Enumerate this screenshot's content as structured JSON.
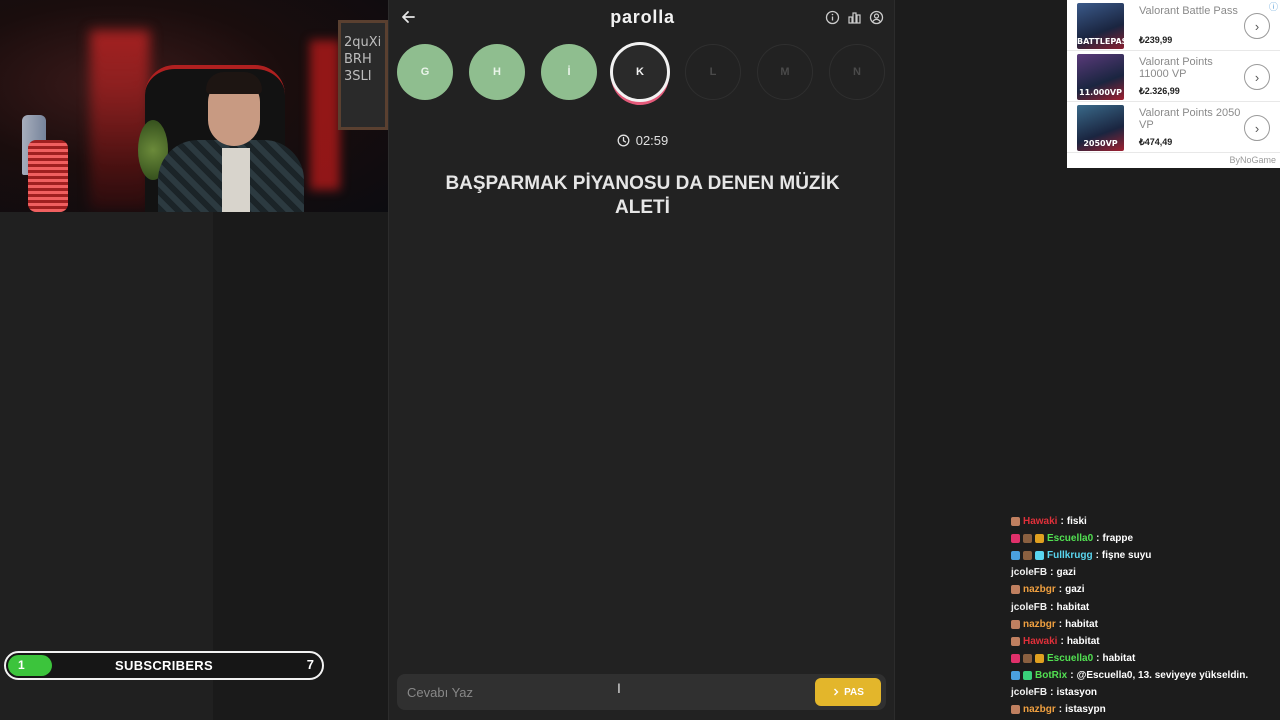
{
  "app": {
    "brand": "parolla"
  },
  "game": {
    "letters": [
      {
        "letter": "G",
        "state": "done"
      },
      {
        "letter": "H",
        "state": "done"
      },
      {
        "letter": "İ",
        "state": "done"
      },
      {
        "letter": "K",
        "state": "active"
      },
      {
        "letter": "L",
        "state": "pending"
      },
      {
        "letter": "M",
        "state": "pending"
      },
      {
        "letter": "N",
        "state": "pending"
      }
    ],
    "timer": "02:59",
    "question": "BAŞPARMAK PİYANOSU DA DENEN MÜZİK ALETİ",
    "answer_placeholder": "Cevabı Yaz",
    "pass_label": "PAS"
  },
  "subscribers": {
    "current": "1",
    "label": "SUBSCRIBERS",
    "goal": "7",
    "progress_fraction": 0.14
  },
  "webcam": {
    "board_text": "2quXi\nBRH\n3SLI"
  },
  "ads": {
    "items": [
      {
        "title": "Valorant Battle Pass",
        "price": "₺239,99",
        "thumb_label": "BATTLEPASS"
      },
      {
        "title": "Valorant Points 11000 VP",
        "price": "₺2.326,99",
        "thumb_label": "11.000VP"
      },
      {
        "title": "Valorant Points 2050 VP",
        "price": "₺474,49",
        "thumb_label": "2050VP"
      }
    ],
    "footer": "ByNoGame"
  },
  "chat": [
    {
      "user": "Hawaki",
      "color": "#e0303a",
      "message": "fiski",
      "badges": [
        "#c08060"
      ]
    },
    {
      "user": "Escuella0",
      "color": "#52e052",
      "message": "frappe",
      "badges": [
        "#e0306a",
        "#8a6040",
        "#e0a020"
      ]
    },
    {
      "user": "Fullkrugg",
      "color": "#5ad6f0",
      "message": "fişne suyu",
      "badges": [
        "#4aa0e0",
        "#8a6040",
        "#5ad6f0"
      ]
    },
    {
      "user": "jcoleFB",
      "color": "#f0f0f0",
      "message": "gazi",
      "badges": []
    },
    {
      "user": "nazbgr",
      "color": "#f0a040",
      "message": "gazi",
      "badges": [
        "#c08060"
      ]
    },
    {
      "user": "jcoleFB",
      "color": "#f0f0f0",
      "message": "habitat",
      "badges": []
    },
    {
      "user": "nazbgr",
      "color": "#f0a040",
      "message": "habitat",
      "badges": [
        "#c08060"
      ]
    },
    {
      "user": "Hawaki",
      "color": "#e0303a",
      "message": "habitat",
      "badges": [
        "#c08060"
      ]
    },
    {
      "user": "Escuella0",
      "color": "#52e052",
      "message": "habitat",
      "badges": [
        "#e0306a",
        "#8a6040",
        "#e0a020"
      ]
    },
    {
      "user": "BotRix",
      "color": "#52e052",
      "message": "@Escuella0, 13. seviyeye yükseldin.",
      "badges": [
        "#4aa0e0",
        "#3ad07a"
      ]
    },
    {
      "user": "jcoleFB",
      "color": "#f0f0f0",
      "message": "istasyon",
      "badges": []
    },
    {
      "user": "nazbgr",
      "color": "#f0a040",
      "message": "istasypn",
      "badges": [
        "#c08060"
      ]
    }
  ]
}
